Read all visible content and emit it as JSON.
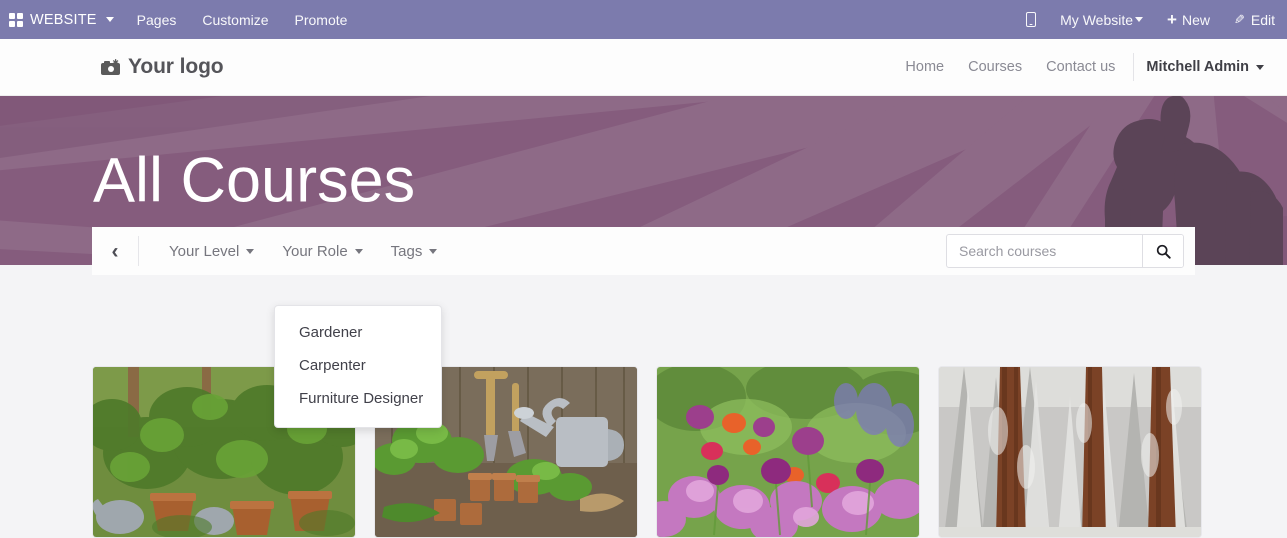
{
  "backend_navbar": {
    "brand": "WEBSITE",
    "menu_items": [
      "Pages",
      "Customize",
      "Promote"
    ],
    "right": {
      "mobile_preview_icon": "mobile-phone-icon",
      "website_selector": "My Website",
      "new_label": "New",
      "edit_label": "Edit"
    },
    "bg_color": "#7c7bad"
  },
  "site_header": {
    "logo_text": "Your logo",
    "logo_icon": "camera-icon",
    "nav_links": [
      "Home",
      "Courses",
      "Contact us"
    ],
    "user_name": "Mitchell Admin"
  },
  "hero": {
    "title": "All Courses",
    "bg_color": "#855c7d",
    "ray_color": "#8e6a87",
    "silhouette_color": "#5b4457"
  },
  "filter_bar": {
    "back_icon": "chevron-left-icon",
    "dropdowns": [
      {
        "label": "Your Level",
        "open": false
      },
      {
        "label": "Your Role",
        "open": true
      },
      {
        "label": "Tags",
        "open": false
      }
    ],
    "search": {
      "placeholder": "Search courses",
      "value": "",
      "button_icon": "search-icon"
    }
  },
  "open_dropdown": {
    "owner": "Your Role",
    "items": [
      "Gardener",
      "Carpenter",
      "Furniture Designer"
    ]
  },
  "courses": [
    {
      "image_alt": "vegetable garden with potted plants and watering cans"
    },
    {
      "image_alt": "garden tools, seedling pots and galvanized watering can"
    },
    {
      "image_alt": "field of purple and pink poppies and flowers"
    },
    {
      "image_alt": "snow covered forest with redwood tree trunks"
    }
  ]
}
